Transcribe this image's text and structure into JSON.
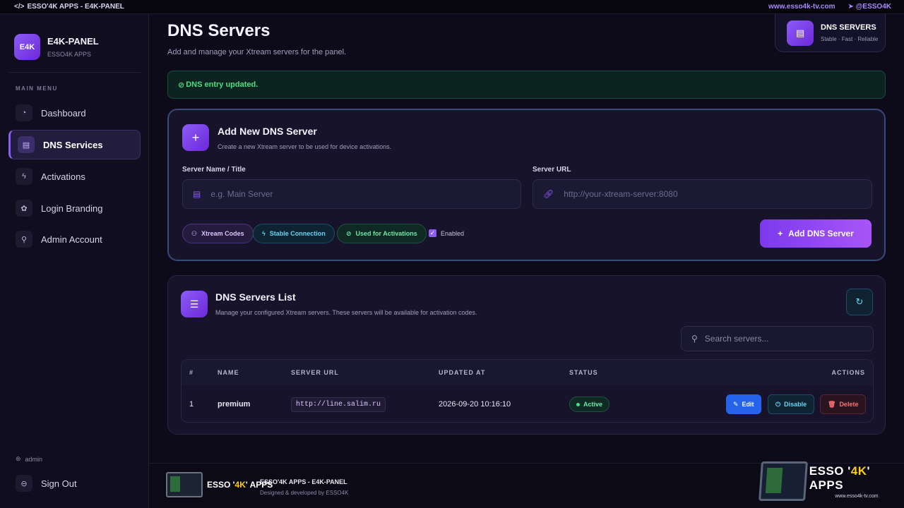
{
  "topbar": {
    "app_label": "ESSO'4K APPS - E4K-PANEL",
    "website": "www.esso4k-tv.com",
    "telegram": "@ESSO4K"
  },
  "sidebar": {
    "logo": "E4K",
    "brand_name": "E4K-PANEL",
    "brand_sub": "ESSO4K APPS",
    "menu_title": "MAIN MENU",
    "items": [
      {
        "label": "Dashboard",
        "icon": "gauge-icon"
      },
      {
        "label": "DNS Services",
        "icon": "server-icon"
      },
      {
        "label": "Activations",
        "icon": "bolt-icon"
      },
      {
        "label": "Login Branding",
        "icon": "palette-icon"
      },
      {
        "label": "Admin Account",
        "icon": "user-cog-icon"
      }
    ],
    "active_index": 1,
    "user": "admin",
    "signout": "Sign Out"
  },
  "header": {
    "title": "DNS Servers",
    "subtitle": "Add and manage your Xtream servers for the panel.",
    "badge_title": "DNS SERVERS",
    "badge_sub": "Stable · Fast · Reliable"
  },
  "alert": {
    "message": "DNS entry updated."
  },
  "add_form": {
    "title": "Add New DNS Server",
    "subtitle": "Create a new Xtream server to be used for device activations.",
    "name_label": "Server Name / Title",
    "name_placeholder": "e.g. Main Server",
    "url_label": "Server URL",
    "url_placeholder": "http://your-xtream-server:8080",
    "chips": [
      "Xtream Codes",
      "Stable Connection",
      "Used for Activations"
    ],
    "enabled_label": "Enabled",
    "enabled": true,
    "submit": "Add DNS Server"
  },
  "list": {
    "title": "DNS Servers List",
    "subtitle": "Manage your configured Xtream servers. These servers will be available for activation codes.",
    "search_placeholder": "Search servers...",
    "columns": [
      "#",
      "NAME",
      "SERVER URL",
      "UPDATED AT",
      "STATUS",
      "ACTIONS"
    ],
    "rows": [
      {
        "index": "1",
        "name": "premium",
        "url": "http://line.salim.ru",
        "updated_at": "2026-09-20 10:16:10",
        "status": "Active"
      }
    ],
    "actions": {
      "edit": "Edit",
      "disable": "Disable",
      "delete": "Delete"
    }
  },
  "footer": {
    "logo_text_a": "ESSO '",
    "logo_text_b": "4K",
    "logo_text_c": "' APPS",
    "title": "ESSO'4K APPS - E4K-PANEL",
    "subtitle": "Designed & developed by ESSO4K",
    "big_logo_url": "www.esso4k-tv.com"
  },
  "colors": {
    "accent": "#8b5cf6",
    "success": "#4ade80",
    "info": "#67d3f5",
    "danger": "#f87171",
    "background": "#0d0b1a"
  }
}
